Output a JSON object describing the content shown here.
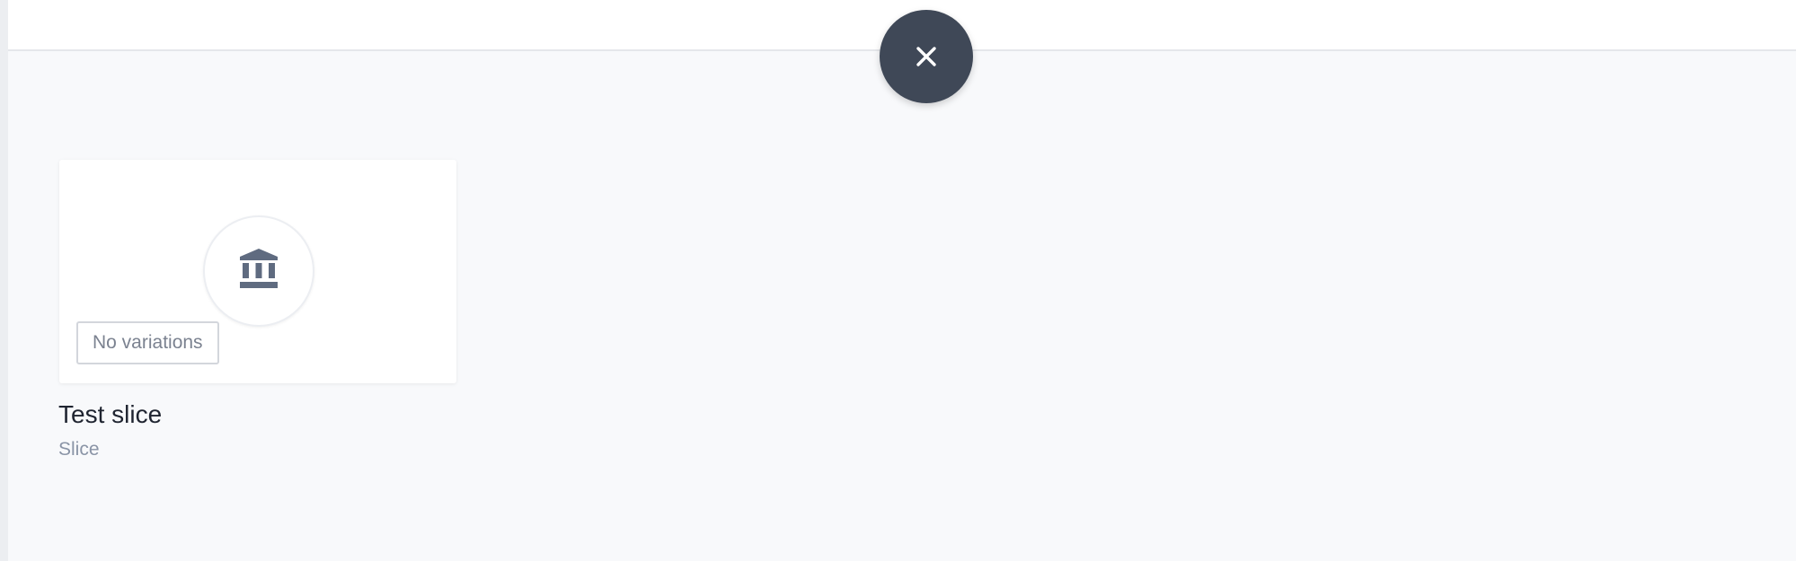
{
  "header": {
    "close_icon": "close-icon"
  },
  "card": {
    "icon": "bank-icon",
    "badge_label": "No variations",
    "name": "Test slice",
    "type": "Slice"
  },
  "colors": {
    "close_button_bg": "#3f4857",
    "icon_color": "#5f6b80",
    "page_bg": "#f8f9fb",
    "title_text": "#1f2430",
    "subtitle_text": "#8a94a6"
  }
}
